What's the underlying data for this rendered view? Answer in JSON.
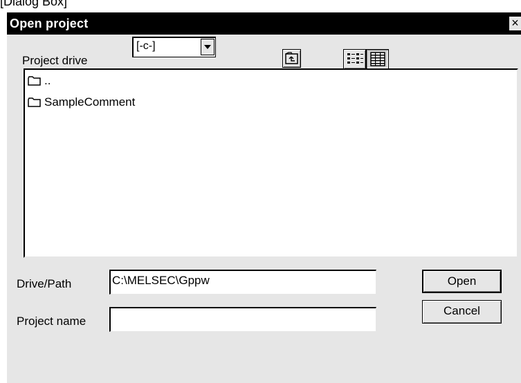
{
  "caption": "[Dialog Box]",
  "dialog": {
    "title": "Open project",
    "close_glyph": "×"
  },
  "project_drive": {
    "label": "Project drive",
    "value": "[-c-]"
  },
  "toolbar": {
    "up_icon": "up-folder-icon",
    "list_icon": "list-view-icon",
    "details_icon": "details-view-icon"
  },
  "file_list": {
    "items": [
      {
        "name": "..",
        "icon": "folder-icon"
      },
      {
        "name": "SampleComment",
        "icon": "folder-icon"
      }
    ]
  },
  "drive_path": {
    "label": "Drive/Path",
    "value": "C:\\MELSEC\\Gppw"
  },
  "project_name": {
    "label": "Project name",
    "value": ""
  },
  "buttons": {
    "open": "Open",
    "cancel": "Cancel"
  }
}
